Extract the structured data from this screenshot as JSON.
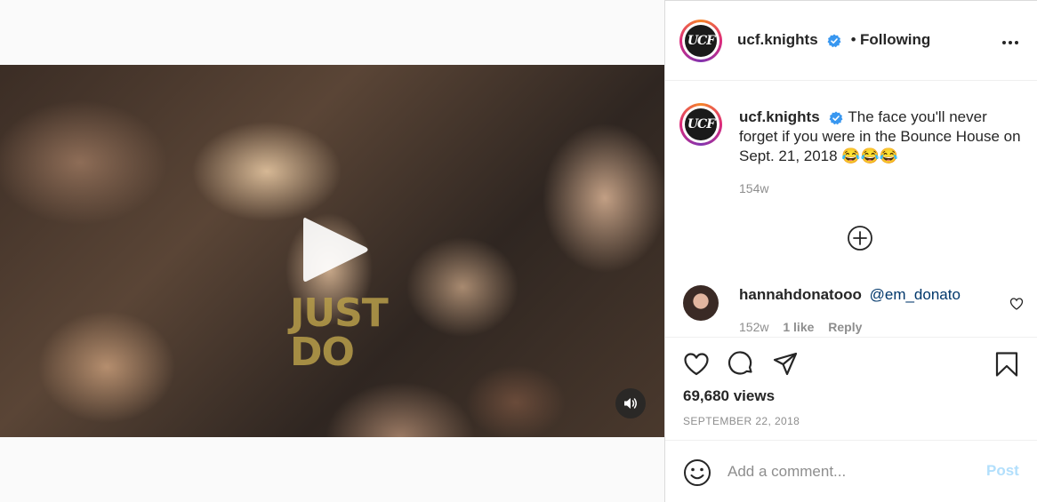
{
  "post": {
    "video": {
      "shirt_text": "JUST\nDO",
      "play_icon": "play-icon",
      "sound_icon": "speaker-icon"
    },
    "header": {
      "avatar_text": "UCF",
      "username": "ucf.knights",
      "verified_icon": "verified-badge-icon",
      "separator": "•",
      "following_label": "Following",
      "more_icon": "more-options-icon"
    },
    "caption": {
      "username": "ucf.knights",
      "text": "The face you'll never forget if you were in the Bounce House on Sept. 21, 2018 😂😂😂",
      "time_ago": "154w",
      "load_more_icon": "plus-circle-icon"
    },
    "comments": [
      {
        "username": "hannahdonatooo",
        "mention": "@em_donato",
        "time_ago": "152w",
        "likes": "1 like",
        "reply_label": "Reply"
      }
    ],
    "actions": {
      "like_icon": "heart-icon",
      "comment_icon": "comment-icon",
      "share_icon": "share-icon",
      "save_icon": "bookmark-icon"
    },
    "views": "69,680 views",
    "date": "SEPTEMBER 22, 2018",
    "add_comment": {
      "placeholder": "Add a comment...",
      "post_label": "Post",
      "emoji_icon": "emoji-icon"
    }
  },
  "colors": {
    "verified": "#3897f0",
    "link": "#00376b",
    "post_disabled": "#b2dffc",
    "muted": "#8e8e8e"
  }
}
